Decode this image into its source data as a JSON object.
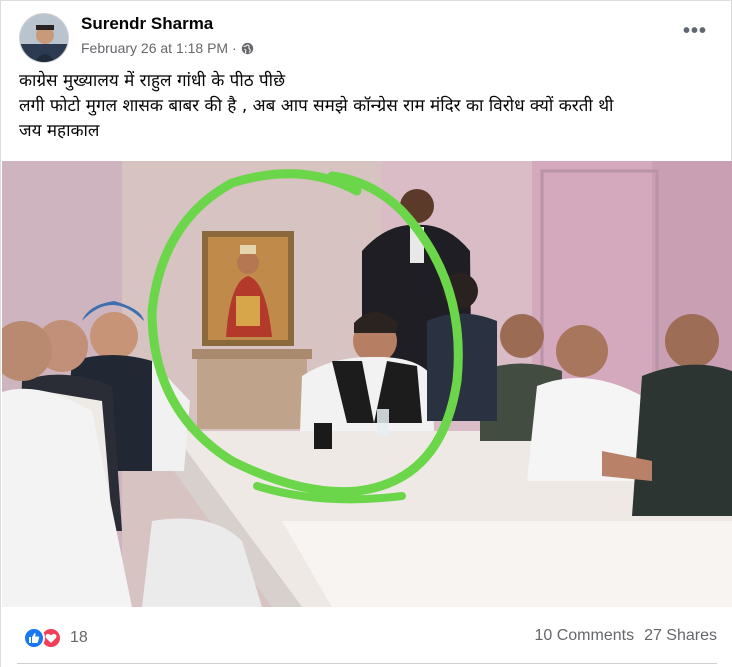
{
  "post": {
    "author": "Surendr Sharma",
    "timestamp": "February 26 at 1:18 PM · ",
    "privacy_icon": "globe-icon",
    "more_label": "•••",
    "text_lines": [
      "काग्रेस मुख्यालय में राहुल गांधी के पीठ पीछे",
      "लगी फोटो मुगल शासक बाबर की है , अब आप समझे कॉन्ग्रेस राम मंदिर का विरोध क्यों करती थी",
      "जय महाकाल"
    ]
  },
  "photo": {
    "description_icon": "photo-of-meeting",
    "highlight_color": "#6bd64a"
  },
  "footer": {
    "reaction_icons": [
      "like-icon",
      "love-icon"
    ],
    "reaction_count": "18",
    "comments": "10 Comments",
    "shares": "27 Shares"
  },
  "colors": {
    "like": "#1877f2",
    "love": "#f33e58",
    "meta": "#65676b"
  }
}
